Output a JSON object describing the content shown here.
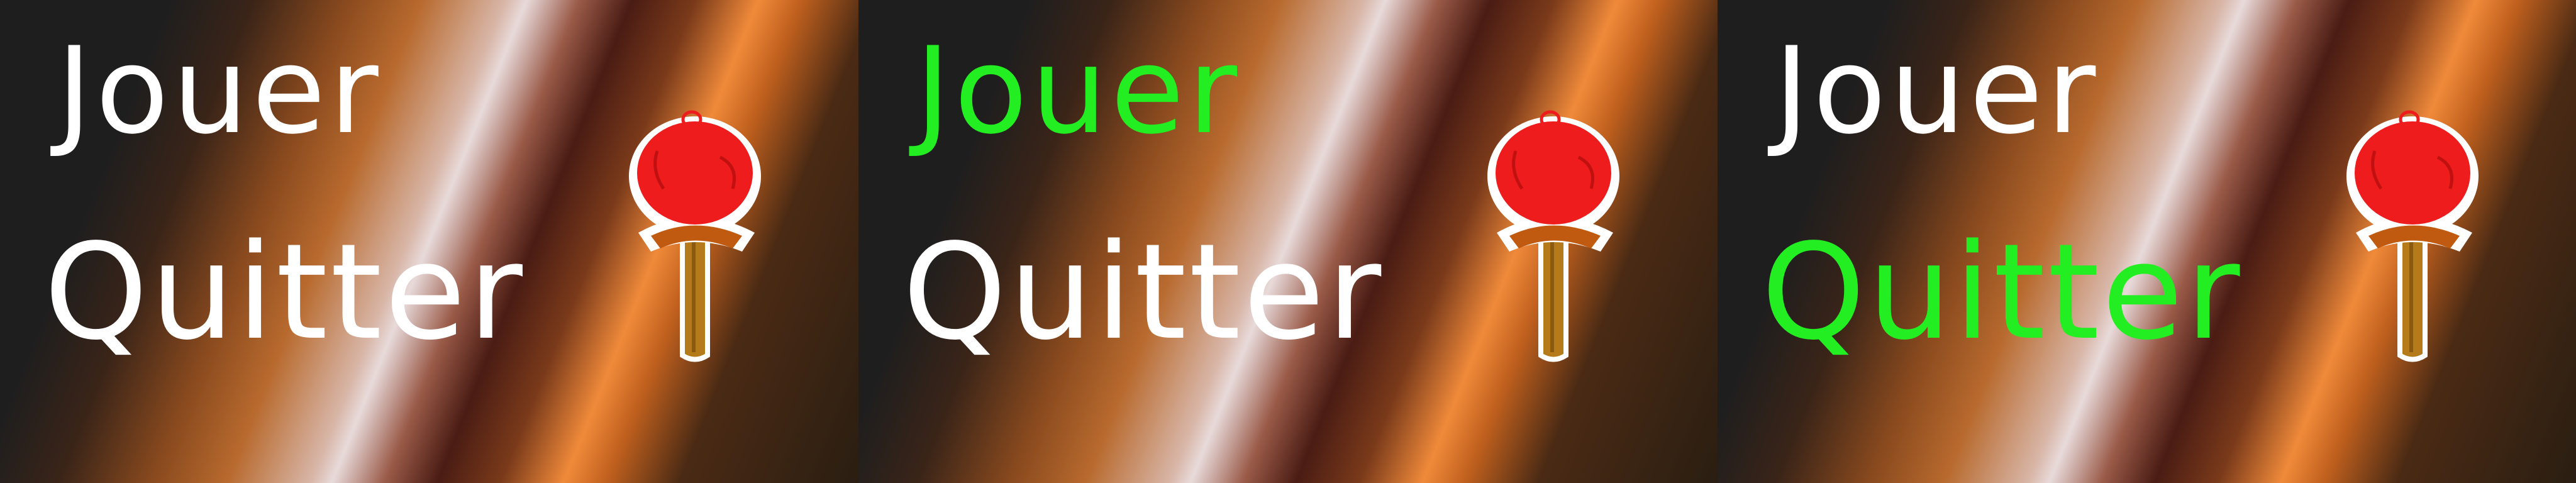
{
  "colors": {
    "idle": "#ffffff",
    "highlight": "#22ee22",
    "paddle_red": "#ee1c1c",
    "handle": "#b57a1a"
  },
  "panels": [
    {
      "state": "idle",
      "jouer": {
        "label": "Jouer",
        "color": "#ffffff"
      },
      "quitter": {
        "label": "Quitter",
        "color": "#ffffff"
      },
      "icon": "table-tennis-paddle-icon"
    },
    {
      "state": "jouer-hover",
      "jouer": {
        "label": "Jouer",
        "color": "#22ee22"
      },
      "quitter": {
        "label": "Quitter",
        "color": "#ffffff"
      },
      "icon": "table-tennis-paddle-icon"
    },
    {
      "state": "quitter-hover",
      "jouer": {
        "label": "Jouer",
        "color": "#ffffff"
      },
      "quitter": {
        "label": "Quitter",
        "color": "#22ee22"
      },
      "icon": "table-tennis-paddle-icon"
    }
  ]
}
